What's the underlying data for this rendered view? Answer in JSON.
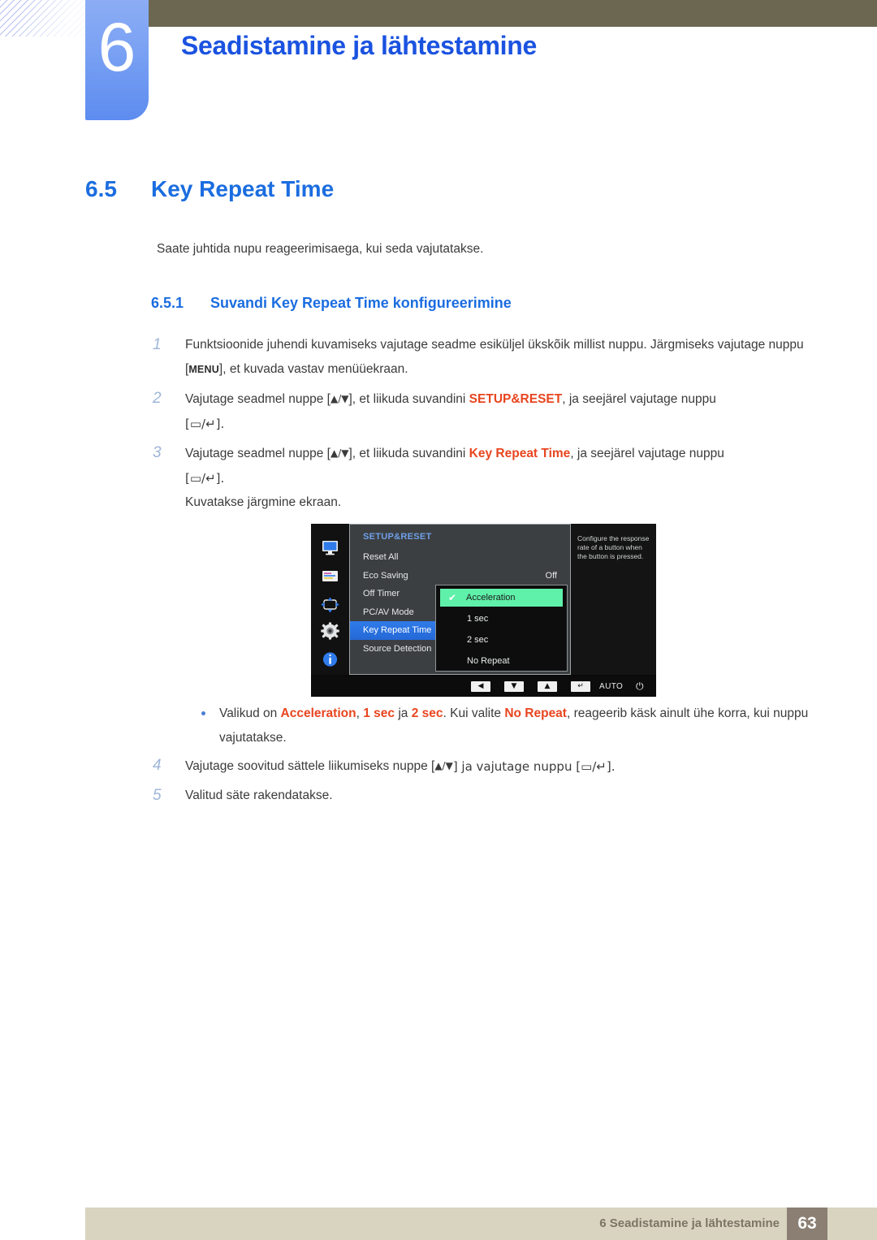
{
  "header": {
    "chapter_number": "6",
    "chapter_title": "Seadistamine ja lähtestamine"
  },
  "section": {
    "number": "6.5",
    "title": "Key Repeat Time",
    "intro": "Saate juhtida nupu reageerimisaega, kui seda vajutatakse.",
    "sub_number": "6.5.1",
    "sub_title": "Suvandi Key Repeat Time konfigureerimine"
  },
  "steps": {
    "s1_num": "1",
    "s1_a": "Funktsioonide juhendi kuvamiseks vajutage seadme esiküljel ükskõik millist nuppu. Järgmiseks vajutage nuppu [",
    "s1_key": "MENU",
    "s1_b": "], et kuvada vastav menüüekraan.",
    "s2_num": "2",
    "s2_a": "Vajutage seadmel nuppe [",
    "s2_arrows": "▲/▼",
    "s2_b": "], et liikuda suvandini ",
    "s2_hl": "SETUP&RESET",
    "s2_c": ", ja seejärel vajutage nuppu",
    "s2_keys": "[▭/↵].",
    "s3_num": "3",
    "s3_a": "Vajutage seadmel nuppe [",
    "s3_arrows": "▲/▼",
    "s3_b": "], et liikuda suvandini ",
    "s3_hl": "Key Repeat Time",
    "s3_c": ", ja seejärel vajutage nuppu",
    "s3_keys": "[▭/↵].",
    "s3_after": "Kuvatakse järgmine ekraan.",
    "note_a": "Valikud on ",
    "note_hl1": "Acceleration",
    "note_b": ", ",
    "note_hl2": "1 sec",
    "note_c": " ja ",
    "note_hl3": "2 sec",
    "note_d": ". Kui valite ",
    "note_hl4": "No Repeat",
    "note_e": ", reageerib käsk ainult ühe korra, kui nuppu vajutatakse.",
    "s4_num": "4",
    "s4_a": "Vajutage soovitud sättele liikumiseks nuppe [",
    "s4_arrows": "▲/▼",
    "s4_b": "] ja vajutage nuppu [▭/↵].",
    "s5_num": "5",
    "s5_text": "Valitud säte rakendatakse."
  },
  "osd": {
    "heading": "SETUP&RESET",
    "menu_items": [
      {
        "label": "Reset All",
        "value": ""
      },
      {
        "label": "Eco Saving",
        "value": "Off"
      },
      {
        "label": "Off Timer",
        "value": ""
      },
      {
        "label": "PC/AV Mode",
        "value": ""
      },
      {
        "label": "Key Repeat Time",
        "value": ""
      },
      {
        "label": "Source Detection",
        "value": ""
      }
    ],
    "submenu": [
      {
        "label": "Acceleration",
        "checked": "✔"
      },
      {
        "label": "1 sec",
        "checked": ""
      },
      {
        "label": "2 sec",
        "checked": ""
      },
      {
        "label": "No Repeat",
        "checked": ""
      }
    ],
    "help_text": "Configure the response rate of a button when the button is pressed.",
    "footer_buttons": [
      "◀",
      "▼",
      "▲",
      "↵"
    ],
    "auto_label": "AUTO",
    "power_glyph": "⏻",
    "icons": [
      "display-icon",
      "picture-icon",
      "screen-adjust-icon",
      "gear-icon",
      "info-icon"
    ],
    "colors": {
      "selected_row": "#2f7bea",
      "active_option": "#5ff0a9",
      "heading": "#6f9fe8"
    }
  },
  "footer": {
    "text": "6 Seadistamine ja lähtestamine",
    "page_number": "63"
  }
}
